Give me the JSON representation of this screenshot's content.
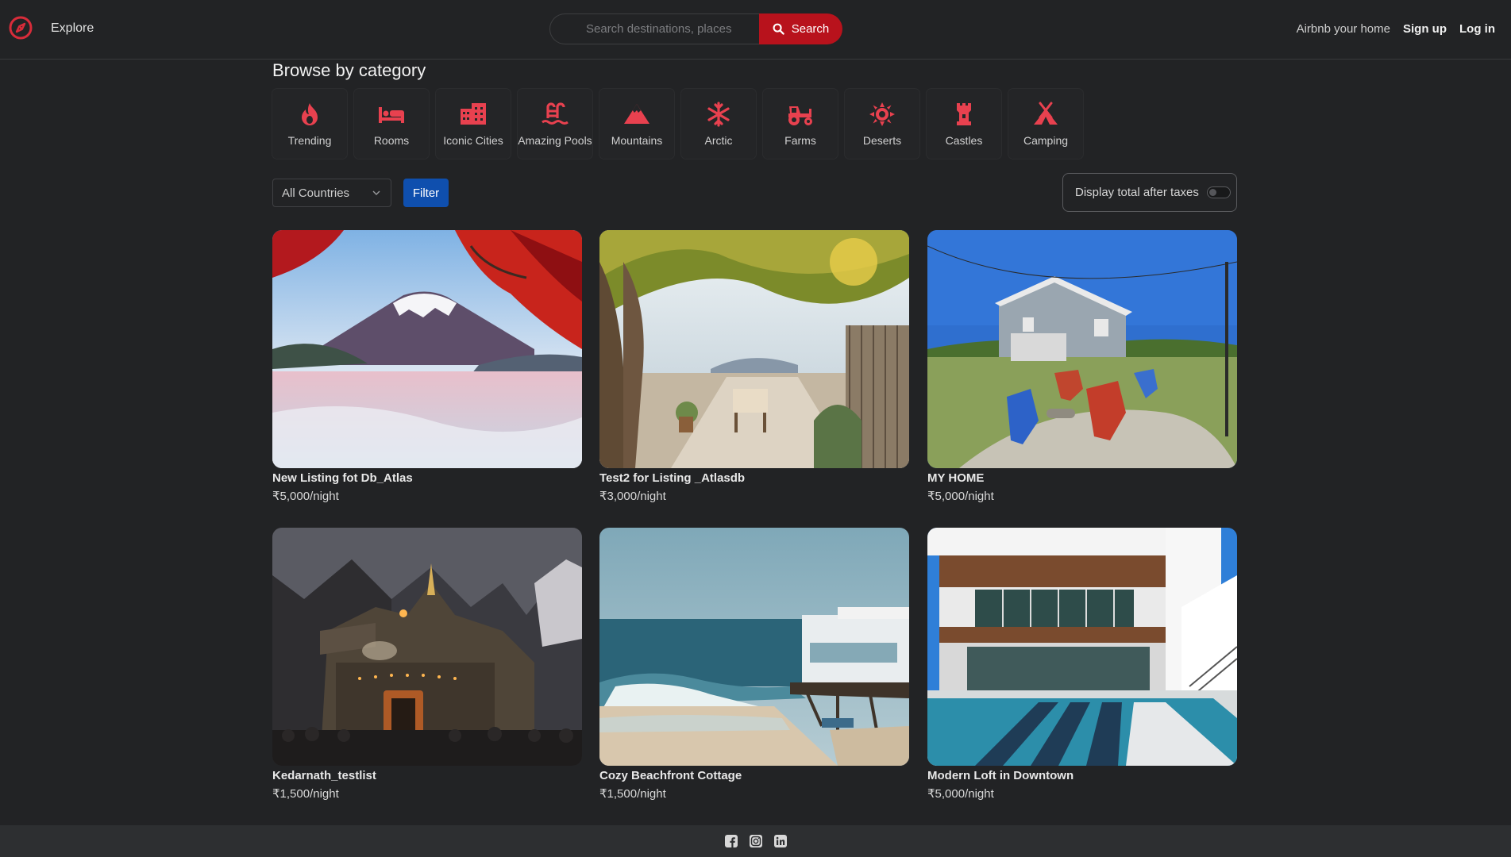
{
  "nav": {
    "brand_icon": "compass-icon",
    "explore_label": "Explore",
    "search_placeholder": "Search destinations, places",
    "search_button_label": "Search",
    "host_link": "Airbnb your home",
    "signup_label": "Sign up",
    "login_label": "Log in",
    "accent_color": "#b8121c"
  },
  "categories": {
    "title": "Browse by category",
    "items": [
      {
        "label": "Trending",
        "icon": "fire-icon"
      },
      {
        "label": "Rooms",
        "icon": "bed-icon"
      },
      {
        "label": "Iconic Cities",
        "icon": "city-icon"
      },
      {
        "label": "Amazing Pools",
        "icon": "pool-icon"
      },
      {
        "label": "Mountains",
        "icon": "mountain-icon"
      },
      {
        "label": "Arctic",
        "icon": "snowflake-icon"
      },
      {
        "label": "Farms",
        "icon": "tractor-icon"
      },
      {
        "label": "Deserts",
        "icon": "sun-icon"
      },
      {
        "label": "Castles",
        "icon": "castle-icon"
      },
      {
        "label": "Camping",
        "icon": "campground-icon"
      }
    ]
  },
  "filters": {
    "country_selected": "All Countries",
    "filter_button": "Filter",
    "tax_toggle_label": "Display total after taxes",
    "tax_toggle_on": false
  },
  "listings": [
    {
      "title": "New Listing fot Db_Atlas",
      "price": "₹5,000/night",
      "image": "mount-fuji-lake-photo"
    },
    {
      "title": "Test2 for Listing _Atlasdb",
      "price": "₹3,000/night",
      "image": "garden-terrace-photo"
    },
    {
      "title": "MY HOME",
      "price": "₹5,000/night",
      "image": "cabin-adirondack-chairs-photo"
    },
    {
      "title": "Kedarnath_testlist",
      "price": "₹1,500/night",
      "image": "stone-temple-night-photo"
    },
    {
      "title": "Cozy Beachfront Cottage",
      "price": "₹1,500/night",
      "image": "beach-house-waves-photo"
    },
    {
      "title": "Modern Loft in Downtown",
      "price": "₹5,000/night",
      "image": "modern-house-pool-photo"
    }
  ],
  "footer": {
    "icons": [
      "facebook-icon",
      "instagram-icon",
      "linkedin-icon"
    ]
  }
}
